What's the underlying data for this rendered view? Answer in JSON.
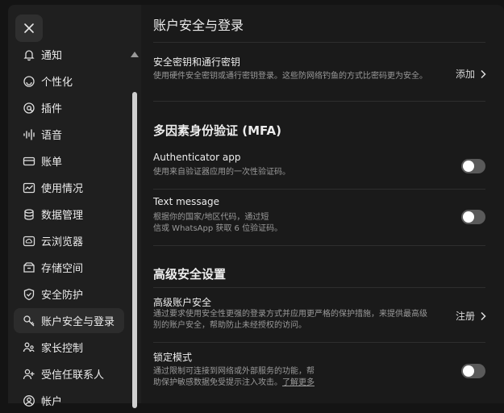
{
  "sidebar": {
    "items": [
      {
        "label": "通知",
        "icon": "bell-icon"
      },
      {
        "label": "个性化",
        "icon": "personalization-icon"
      },
      {
        "label": "插件",
        "icon": "plugin-icon"
      },
      {
        "label": "语音",
        "icon": "voice-icon"
      },
      {
        "label": "账单",
        "icon": "card-icon"
      },
      {
        "label": "使用情况",
        "icon": "usage-icon"
      },
      {
        "label": "数据管理",
        "icon": "database-icon"
      },
      {
        "label": "云浏览器",
        "icon": "cloud-browser-icon"
      },
      {
        "label": "存储空间",
        "icon": "storage-icon"
      },
      {
        "label": "安全防护",
        "icon": "shield-icon"
      },
      {
        "label": "账户安全与登录",
        "icon": "key-icon",
        "active": true
      },
      {
        "label": "家长控制",
        "icon": "family-icon"
      },
      {
        "label": "受信任联系人",
        "icon": "trusted-contact-icon"
      },
      {
        "label": "帐户",
        "icon": "account-icon"
      }
    ]
  },
  "main": {
    "title": "账户安全与登录",
    "passkeys": {
      "title": "安全密钥和通行密钥",
      "desc": "使用硬件安全密钥或通行密钥登录。这些防网络钓鱼的方式比密码更为安全。",
      "action": "添加"
    },
    "mfa": {
      "title": "多因素身份验证 (MFA)",
      "authenticator": {
        "title": "Authenticator app",
        "desc": "使用来自验证器应用的一次性验证码。",
        "enabled": false
      },
      "sms": {
        "title": "Text message",
        "desc_line1": "根据你的国家/地区代码，通过短",
        "desc_line2": "信或 WhatsApp 获取 6 位验证码。",
        "enabled": false
      }
    },
    "advanced": {
      "title": "高级安全设置",
      "account": {
        "title": "高级账户安全",
        "desc": "通过要求使用安全性更强的登录方式并应用更严格的保护措施，来提供最高级别的账户安全，帮助防止未经授权的访问。",
        "action": "注册"
      },
      "lockdown": {
        "title": "锁定模式",
        "desc_line1": "通过限制可连接到网络或外部服务的功能，帮",
        "desc_line2": "助保护敏感数据免受提示注入攻击。",
        "link": "了解更多",
        "enabled": false
      }
    }
  }
}
